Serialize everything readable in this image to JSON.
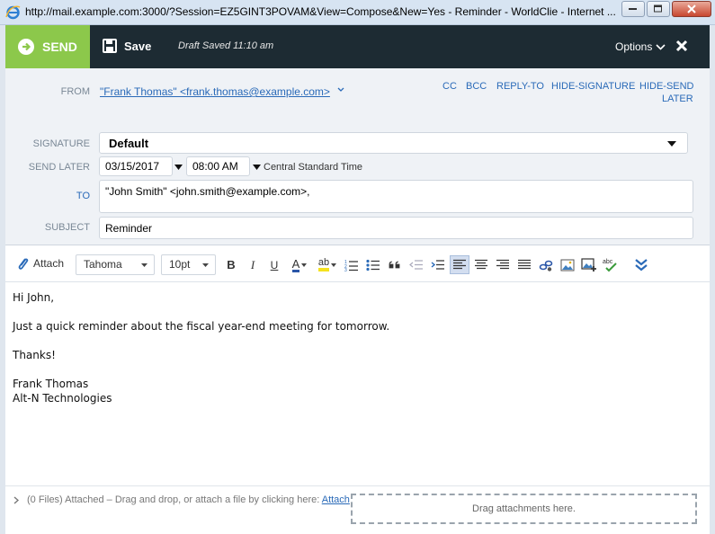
{
  "window": {
    "title": "http://mail.example.com:3000/?Session=EZ5GINT3POVAM&View=Compose&New=Yes - Reminder - WorldClie - Internet ..."
  },
  "toolbar": {
    "send_label": "SEND",
    "save_label": "Save",
    "draft_status": "Draft Saved 11:10 am",
    "options_label": "Options"
  },
  "header": {
    "from_label": "FROM",
    "from_value": "\"Frank Thomas\" <frank.thomas@example.com>",
    "links": [
      "CC",
      "BCC",
      "REPLY-TO",
      "HIDE-SIGNATURE",
      "HIDE-SEND"
    ],
    "links_wrap": "LATER",
    "signature_label": "SIGNATURE",
    "signature_value": "Default",
    "send_later_label": "SEND LATER",
    "send_date": "03/15/2017",
    "send_time": "08:00 AM",
    "timezone": "Central Standard Time",
    "to_label": "TO",
    "to_value": "\"John Smith\" <john.smith@example.com>,",
    "subject_label": "SUBJECT",
    "subject_value": "Reminder"
  },
  "editor": {
    "attach_label": "Attach",
    "font_family": "Tahoma",
    "font_size": "10pt",
    "buttons": [
      "bold-icon",
      "italic-icon",
      "underline-icon",
      "font-color-icon",
      "highlight-icon",
      "numbered-list-icon",
      "bulleted-list-icon",
      "quote-icon",
      "outdent-icon",
      "indent-icon",
      "align-left-icon",
      "align-center-icon",
      "align-right-icon",
      "justify-icon",
      "link-icon",
      "image-icon",
      "insert-image-icon",
      "spellcheck-icon",
      "expand-icon"
    ],
    "bold": "B",
    "italic": "I",
    "underline": "U",
    "font_color_letter": "A",
    "highlight_letters": "ab"
  },
  "body": {
    "greeting": "Hi John,",
    "line1": "Just a quick reminder about the fiscal year-end meeting for tomorrow.",
    "thanks": "Thanks!",
    "sig_name": "Frank Thomas",
    "sig_company": "Alt-N Technologies"
  },
  "footer": {
    "files_text": "(0 Files) Attached – Drag and drop, or attach a file by clicking here: ",
    "attach_link": "Attach",
    "drop_text": "Drag attachments here."
  },
  "colors": {
    "send_green": "#8cc84b",
    "topbar_dark": "#1d2b33",
    "link_blue": "#2a6ab8"
  }
}
